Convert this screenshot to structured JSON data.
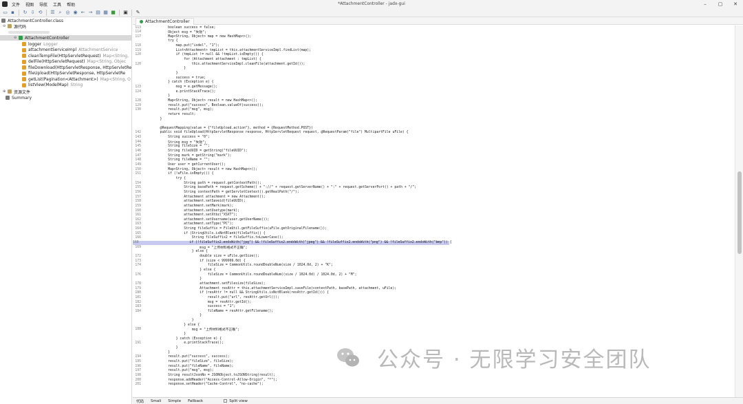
{
  "menu": [
    "文件",
    "视图",
    "导航",
    "工具",
    "帮助"
  ],
  "window_title": "*AttachmentController - jadx-gui",
  "window_controls": [
    "–",
    "▢",
    "✕"
  ],
  "toolbar_icons": [
    "open-folder-icon",
    "save-icon",
    "refresh-icon",
    "export-icon",
    "sync-icon",
    "tree-icon",
    "search-icon",
    "find-class-icon",
    "settings-icon",
    "back-icon",
    "forward-icon",
    "log-icon",
    "decompile-icon",
    "code-icon",
    "stop-icon",
    "wrench-icon"
  ],
  "tree": {
    "root": "AttachmentController.class",
    "source": "源代码",
    "class": "AttachmentController",
    "members": [
      {
        "name": "logger",
        "type": "Logger",
        "kind": "field"
      },
      {
        "name": "attachmentServiceImpl",
        "type": "AttachmentService",
        "kind": "field"
      },
      {
        "name": "cleanTempFile(HttpServletRequest)",
        "type": "Map<String,",
        "kind": "method"
      },
      {
        "name": "delFile(HttpServletRequest)",
        "type": "Map<String, Objec",
        "kind": "method"
      },
      {
        "name": "fileDownload(HttpServletResponse, HttpServletRe",
        "type": "",
        "kind": "method"
      },
      {
        "name": "fileUpload(HttpServletResponse, HttpServletRe",
        "type": "",
        "kind": "method"
      },
      {
        "name": "getList(Pagination<Attachment>)",
        "type": "Map<String, O",
        "kind": "method"
      },
      {
        "name": "listView(ModelMap)",
        "type": "String",
        "kind": "method"
      }
    ],
    "resources": "资源文件",
    "summary": "Summary"
  },
  "editor_tab": "AttachmentController",
  "code_lines": [
    {
      "n": "113",
      "t": "        boolean success = false;"
    },
    {
      "n": "114",
      "t": "        Object msg = \"失败\";"
    },
    {
      "n": "117",
      "t": "        Map<String, Object> map = new HashMap<>();"
    },
    {
      "n": "",
      "t": "        try {"
    },
    {
      "n": "118",
      "t": "            map.put(\"isdel\", \"1\");"
    },
    {
      "n": "119",
      "t": "            List<Attachment> tmpList = this.attachmentServiceImpl.findList(map);"
    },
    {
      "n": "120",
      "t": "            if (tmpList != null && !tmpList.isEmpty()) {"
    },
    {
      "n": "",
      "t": "                for (Attachment attachment : tmpList) {"
    },
    {
      "n": "120",
      "t": "                    this.attachmentServiceImpl.cleanFile(attachment.getId());"
    },
    {
      "n": "",
      "t": "                }"
    },
    {
      "n": "",
      "t": "            }"
    },
    {
      "n": "",
      "t": "            success = true;"
    },
    {
      "n": "",
      "t": "        } catch (Exception e) {"
    },
    {
      "n": "123",
      "t": "            msg = e.getMessage();"
    },
    {
      "n": "124",
      "t": "            e.printStackTrace();"
    },
    {
      "n": "",
      "t": "        }"
    },
    {
      "n": "128",
      "t": "        Map<String, Object> result = new HashMap<>();"
    },
    {
      "n": "129",
      "t": "        result.put(\"success\", Boolean.valueOf(success));"
    },
    {
      "n": "130",
      "t": "        result.put(\"msg\", msg);"
    },
    {
      "n": "",
      "t": "        return result;"
    },
    {
      "n": "",
      "t": "    }"
    },
    {
      "n": "",
      "t": ""
    },
    {
      "n": "",
      "t": "    @RequestMapping(value = {\"fileUpload.action\"}, method = {RequestMethod.POST})"
    },
    {
      "n": "142",
      "t": "    public void fileUpload(HttpServletResponse response, HttpServletRequest request, @RequestParam(\"file\") MultipartFile uFile) {"
    },
    {
      "n": "143",
      "t": "        String success = \"0\";"
    },
    {
      "n": "144",
      "t": "        String msg = \"失败\";"
    },
    {
      "n": "145",
      "t": "        String fileSize = \"\";"
    },
    {
      "n": "146",
      "t": "        String fileUUID = getString(\"fileUUID\");"
    },
    {
      "n": "147",
      "t": "        String mark = getString(\"mark\");"
    },
    {
      "n": "148",
      "t": "        String fileName = \"\";"
    },
    {
      "n": "149",
      "t": "        User user = getCurrentUser();"
    },
    {
      "n": "150",
      "t": "        Map<String, Object> result = new HashMap<>();"
    },
    {
      "n": "151",
      "t": "        if (!uFile.isEmpty()) {"
    },
    {
      "n": "",
      "t": "            try {"
    },
    {
      "n": "154",
      "t": "                String path = request.getContextPath();"
    },
    {
      "n": "155",
      "t": "                String basePath = request.getScheme() + \"://\" + request.getServerName() + \":\" + request.getServerPort() + path + \"/\";"
    },
    {
      "n": "156",
      "t": "                String contextPath = getServletContext().getRealPath(\"/\");"
    },
    {
      "n": "157",
      "t": "                Attachment attachment = new Attachment();"
    },
    {
      "n": "158",
      "t": "                attachment.setSaveid(fileUUID);"
    },
    {
      "n": "159",
      "t": "                attachment.setMark(mark);"
    },
    {
      "n": "160",
      "t": "                attachment.setUsetype(mark);"
    },
    {
      "n": "161",
      "t": "                attachment.setXtbz(\"XSXT\");"
    },
    {
      "n": "162",
      "t": "                attachment.setUsername(user.getUserName());"
    },
    {
      "n": "163",
      "t": "                attachment.setType(\"PC\");"
    },
    {
      "n": "164",
      "t": "                String fileSuffix = FileUtil.getFileSuffix(uFile.getOriginalFilename());"
    },
    {
      "n": "165",
      "t": "                if (StringUtils.isNotBlank(fileSuffix)) {"
    },
    {
      "n": "166",
      "t": "                    String fileSuffix2 = fileSuffix.toLowerCase();"
    },
    {
      "n": "168",
      "t": "                    if (!fileSuffix2.endsWith(\"jpg\") && !fileSuffix2.endsWith(\"jpeg\") && !fileSuffix2.endsWith(\"png\") && !fileSuffix2.endsWith(\"bmp\")) {",
      "hl": true
    },
    {
      "n": "169",
      "t": "                        msg = \"上传材料格式不正确\";"
    },
    {
      "n": "",
      "t": "                    } else {"
    },
    {
      "n": "172",
      "t": "                        double size = uFile.getSize();"
    },
    {
      "n": "173",
      "t": "                        if (size < 999999.0d) {"
    },
    {
      "n": "174",
      "t": "                            fileSize = CommonUtils.roundDoubleNum(size / 1024.0d, 2) + \"K\";"
    },
    {
      "n": "",
      "t": "                        } else {"
    },
    {
      "n": "176",
      "t": "                            fileSize = CommonUtils.roundDoubleNum((size / 1024.0d) / 1024.0d, 2) + \"M\";"
    },
    {
      "n": "",
      "t": "                        }"
    },
    {
      "n": "178",
      "t": "                        attachment.setFilesize(fileSize);"
    },
    {
      "n": "179",
      "t": "                        Attachment resAttr = this.attachmentServiceImpl.saveFile(contextPath, basePath, attachment, uFile);"
    },
    {
      "n": "180",
      "t": "                        if (resAttr != null && StringUtils.isNotBlank(resAttr.getId())) {"
    },
    {
      "n": "181",
      "t": "                            result.put(\"url\", resAttr.getUrl());"
    },
    {
      "n": "182",
      "t": "                            msg = resAttr.getId();"
    },
    {
      "n": "183",
      "t": "                            success = \"1\";"
    },
    {
      "n": "184",
      "t": "                            fileName = resAttr.getFilename();"
    },
    {
      "n": "",
      "t": "                        }"
    },
    {
      "n": "",
      "t": "                    }"
    },
    {
      "n": "",
      "t": "                } else {"
    },
    {
      "n": "188",
      "t": "                    msg = \"上传材料格式不正确\";"
    },
    {
      "n": "",
      "t": "                }"
    },
    {
      "n": "",
      "t": "            } catch (Exception e) {"
    },
    {
      "n": "191",
      "t": "                e.printStackTrace();"
    },
    {
      "n": "",
      "t": "            }"
    },
    {
      "n": "",
      "t": "        }"
    },
    {
      "n": "194",
      "t": "        result.put(\"success\", success);"
    },
    {
      "n": "195",
      "t": "        result.put(\"fileSize\", fileSize);"
    },
    {
      "n": "196",
      "t": "        result.put(\"fileName\", fileName);"
    },
    {
      "n": "197",
      "t": "        result.put(\"msg\", msg);"
    },
    {
      "n": "198",
      "t": "        String resultJsonNo = JSONObject.toJSONString(result);"
    },
    {
      "n": "200",
      "t": "        response.addHeader(\"Access-Control-Allow-Origin\", \"*\");"
    },
    {
      "n": "201",
      "t": "        response.setHeader(\"Cache-Control\", \"no-cache\");"
    }
  ],
  "bottom_tabs": [
    "代码",
    "Smali",
    "Simple",
    "Fallback"
  ],
  "split_view_label": "Split view",
  "watermark": "公众号 · 无限学习安全团队"
}
